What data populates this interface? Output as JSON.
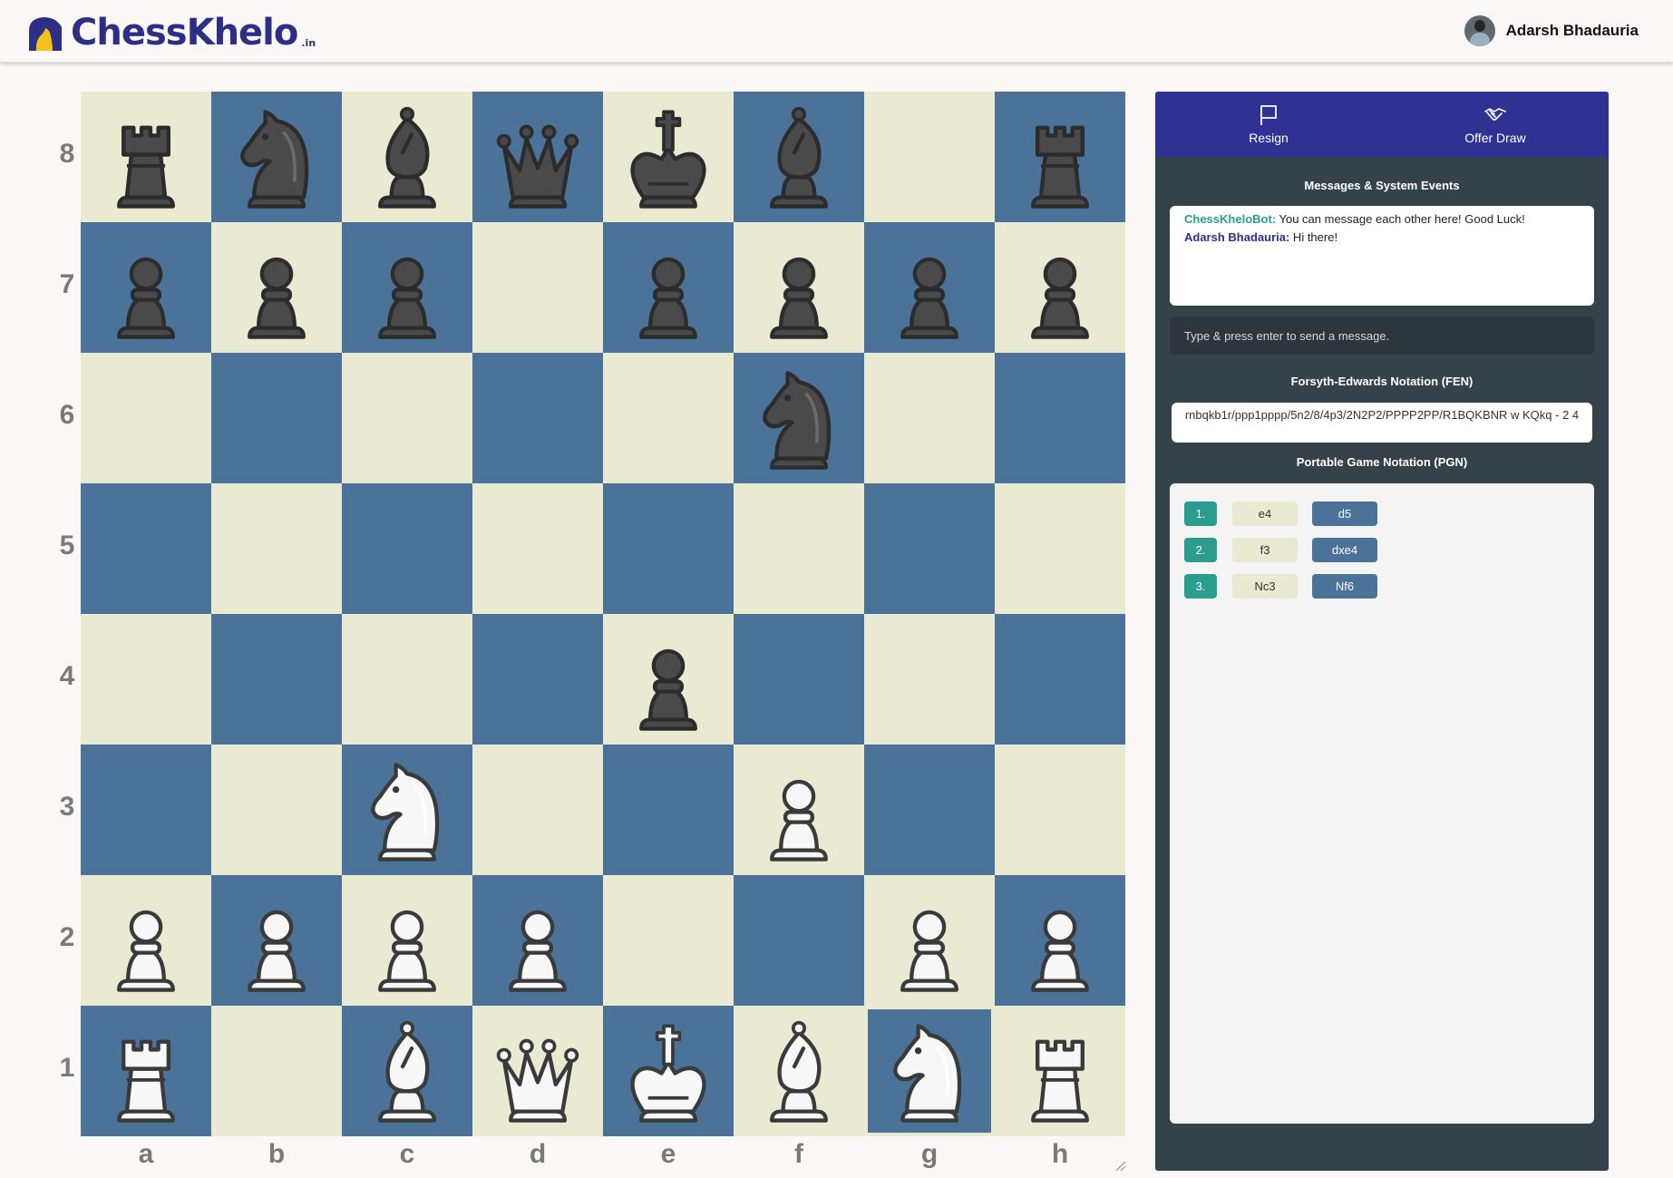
{
  "header": {
    "logo_text": "ChessKhelo",
    "logo_sub": ".in",
    "user_name": "Adarsh Bhadauria"
  },
  "board": {
    "ranks": [
      "8",
      "7",
      "6",
      "5",
      "4",
      "3",
      "2",
      "1"
    ],
    "files": [
      "a",
      "b",
      "c",
      "d",
      "e",
      "f",
      "g",
      "h"
    ],
    "selected_square": "g1",
    "position": [
      [
        "br",
        "bn",
        "bb",
        "bq",
        "bk",
        "bb",
        "",
        "br"
      ],
      [
        "bp",
        "bp",
        "bp",
        "",
        "bp",
        "bp",
        "bp",
        "bp"
      ],
      [
        "",
        "",
        "",
        "",
        "",
        "bn",
        "",
        ""
      ],
      [
        "",
        "",
        "",
        "",
        "",
        "",
        "",
        ""
      ],
      [
        "",
        "",
        "",
        "",
        "bp",
        "",
        "",
        ""
      ],
      [
        "",
        "",
        "wn",
        "",
        "",
        "wp",
        "",
        ""
      ],
      [
        "wp",
        "wp",
        "wp",
        "wp",
        "",
        "",
        "wp",
        "wp"
      ],
      [
        "wr",
        "",
        "wb",
        "wq",
        "wk",
        "wb",
        "wn",
        "wr"
      ]
    ],
    "light_color": "#eaead2",
    "dark_color": "#4b7299"
  },
  "actions": {
    "resign_label": "Resign",
    "draw_label": "Offer Draw"
  },
  "chat": {
    "title": "Messages & System Events",
    "messages": [
      {
        "author": "ChessKheloBot:",
        "text": " You can message each other here! Good Luck!"
      },
      {
        "author": "Adarsh Bhadauria:",
        "text": " Hi there!"
      }
    ],
    "input_placeholder": "Type & press enter to send a message."
  },
  "fen": {
    "title": "Forsyth-Edwards Notation (FEN)",
    "value": "rnbqkb1r/ppp1pppp/5n2/8/4p3/2N2P2/PPPP2PP/R1BQKBNR w KQkq - 2 4"
  },
  "pgn": {
    "title": "Portable Game Notation (PGN)",
    "moves": [
      {
        "num": "1.",
        "white": "e4",
        "black": "d5"
      },
      {
        "num": "2.",
        "white": "f3",
        "black": "dxe4"
      },
      {
        "num": "3.",
        "white": "Nc3",
        "black": "Nf6"
      }
    ]
  },
  "colors": {
    "brand": "#2d2f86",
    "accent": "#2a9d8f",
    "panel": "#35424a"
  }
}
